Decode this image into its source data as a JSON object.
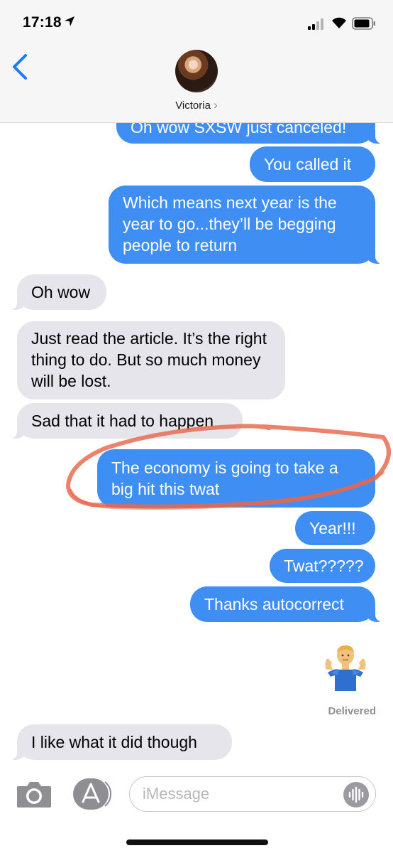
{
  "status_bar": {
    "time": "17:18"
  },
  "header": {
    "contact_name": "Victoria",
    "chevron": "›"
  },
  "messages": [
    {
      "direction": "out",
      "text": "Oh wow SXSW just canceled!"
    },
    {
      "direction": "out",
      "text": "You called it"
    },
    {
      "direction": "out",
      "text": "Which means next year is the year to go...they’ll be begging people to return"
    },
    {
      "direction": "in",
      "text": "Oh wow"
    },
    {
      "direction": "in",
      "text": "Just read the article. It’s the right thing to do. But so much money will be lost."
    },
    {
      "direction": "in",
      "text": "Sad that it had to happen"
    },
    {
      "direction": "out",
      "text": "The economy is going to take a big hit this twat"
    },
    {
      "direction": "out",
      "text": "Year!!!"
    },
    {
      "direction": "out",
      "text": "Twat?????"
    },
    {
      "direction": "out",
      "text": "Thanks autocorrect"
    },
    {
      "direction": "out",
      "emoji": "🤷‍♂️"
    },
    {
      "direction": "in",
      "text": "I like what it did though"
    }
  ],
  "delivered_label": "Delivered",
  "input": {
    "placeholder": "iMessage"
  },
  "colors": {
    "outgoing_bubble": "#3f8ef4",
    "incoming_bubble": "#e6e5eb",
    "accent": "#1a7cf5",
    "annotation": "#e8664a"
  },
  "icons": [
    "location-arrow-icon",
    "cellular-signal-icon",
    "wifi-icon",
    "battery-icon",
    "back-chevron-icon",
    "camera-icon",
    "app-store-icon",
    "audio-waveform-icon",
    "person-shrugging-icon"
  ]
}
